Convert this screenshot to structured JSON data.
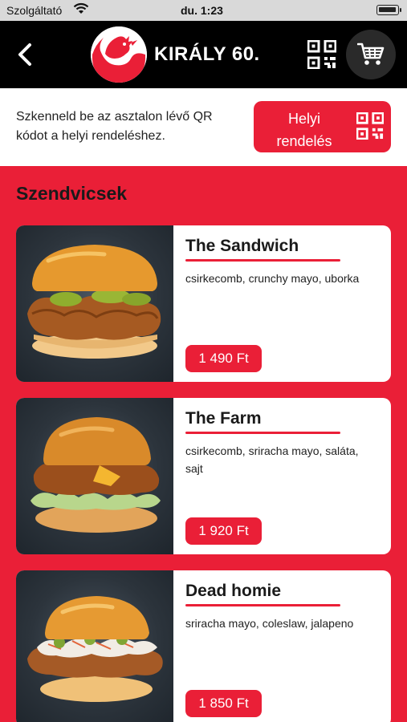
{
  "status_bar": {
    "carrier": "Szolgáltató",
    "time": "du. 1:23"
  },
  "header": {
    "title": "KIRÁLY 60."
  },
  "info": {
    "text": "Szkenneld be az asztalon lévő QR kódot a helyi rendeléshez.",
    "button_label_line1": "Helyi",
    "button_label_line2": "rendelés"
  },
  "section": {
    "title": "Szendvicsek"
  },
  "products": [
    {
      "name": "The Sandwich",
      "description": "csirkecomb, crunchy mayo, uborka",
      "price": "1 490 Ft"
    },
    {
      "name": "The Farm",
      "description": "csirkecomb, sriracha mayo, saláta, sajt",
      "price": "1 920 Ft"
    },
    {
      "name": "Dead homie",
      "description": "sriracha mayo, coleslaw, jalapeno",
      "price": "1 850 Ft"
    }
  ],
  "colors": {
    "accent": "#ea1f37",
    "header_bg": "#000000",
    "status_bg": "#d9d9d9"
  }
}
